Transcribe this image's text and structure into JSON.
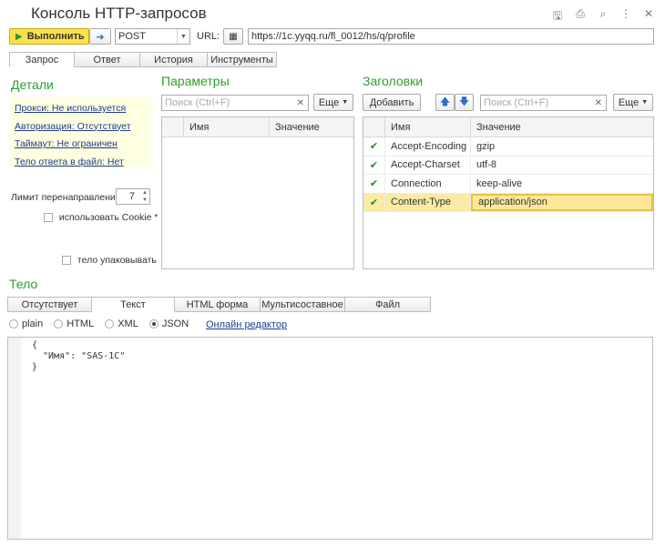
{
  "window": {
    "title": "Консоль  HTTP-запросов"
  },
  "toolbar": {
    "run_label": "Выполнить",
    "method": "POST",
    "url_label": "URL:",
    "url_value": "https://1c.yyqq.ru/fl_0012/hs/q/profile"
  },
  "main_tabs": [
    "Запрос",
    "Ответ",
    "История",
    "Инструменты"
  ],
  "details": {
    "title": "Детали",
    "links": [
      "Прокси: Не используется",
      "Авторизация: Отсутствует",
      "Таймаут: Не ограничен",
      "Тело ответа в файл: Нет"
    ],
    "redirect_label": "Лимит перенаправлений:",
    "redirect_value": "7",
    "cookie_label": "использовать Cookie *",
    "pack_label": "тело упаковывать"
  },
  "params": {
    "title": "Параметры",
    "search_placeholder": "Поиск (Ctrl+F)",
    "more_label": "Еще",
    "columns": [
      "Имя",
      "Значение"
    ]
  },
  "headers": {
    "title": "Заголовки",
    "add_label": "Добавить",
    "search_placeholder": "Поиск (Ctrl+F)",
    "more_label": "Еще",
    "columns": [
      "Имя",
      "Значение"
    ],
    "rows": [
      {
        "name": "Accept-Encoding",
        "value": "gzip"
      },
      {
        "name": "Accept-Charset",
        "value": "utf-8"
      },
      {
        "name": "Connection",
        "value": "keep-alive"
      },
      {
        "name": "Content-Type",
        "value": "application/json"
      }
    ]
  },
  "body": {
    "title": "Тело",
    "tabs": [
      "Отсутствует",
      "Текст",
      "HTML форма",
      "Мультисоставное",
      "Файл"
    ],
    "formats": [
      "plain",
      "HTML",
      "XML",
      "JSON"
    ],
    "selected_format": "JSON",
    "editor_link": "Онлайн редактор",
    "content": "{\n  \"Имя\": \"SAS-1C\"\n}"
  },
  "icons": [
    "save-icon",
    "print-icon",
    "preview-icon",
    "more-icon",
    "close-icon",
    "play-icon",
    "arrow-right-icon",
    "picker-icon",
    "arrow-up-icon",
    "arrow-down-icon",
    "clear-icon",
    "check-icon"
  ]
}
